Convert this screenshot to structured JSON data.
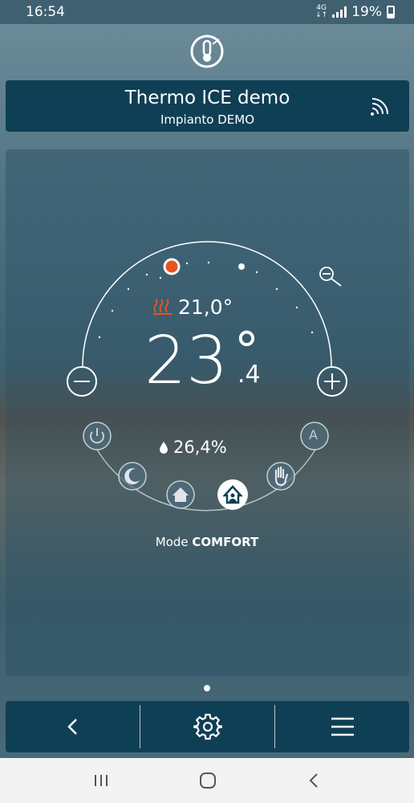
{
  "status": {
    "time": "16:54",
    "network": "4G",
    "battery": "19%"
  },
  "header": {
    "title": "Thermo ICE demo",
    "subtitle": "Impianto DEMO"
  },
  "thermostat": {
    "setpoint": "21,0°",
    "temp_integer": "23",
    "temp_degree": "°",
    "temp_decimal": ".4",
    "humidity": "26,4%",
    "mode_prefix": "Mode",
    "mode_value": "COMFORT"
  },
  "modes": [
    {
      "name": "off",
      "icon": "power-icon",
      "selected": false
    },
    {
      "name": "night",
      "icon": "moon-icon",
      "selected": false
    },
    {
      "name": "home",
      "icon": "house-icon",
      "selected": false
    },
    {
      "name": "comfort",
      "icon": "comfort-house-icon",
      "selected": true
    },
    {
      "name": "manual",
      "icon": "hand-icon",
      "selected": false
    },
    {
      "name": "auto",
      "label": "A",
      "icon": "auto-icon",
      "selected": false
    }
  ],
  "colors": {
    "accent_heat": "#e8541e",
    "panel": "#0f3f55"
  }
}
